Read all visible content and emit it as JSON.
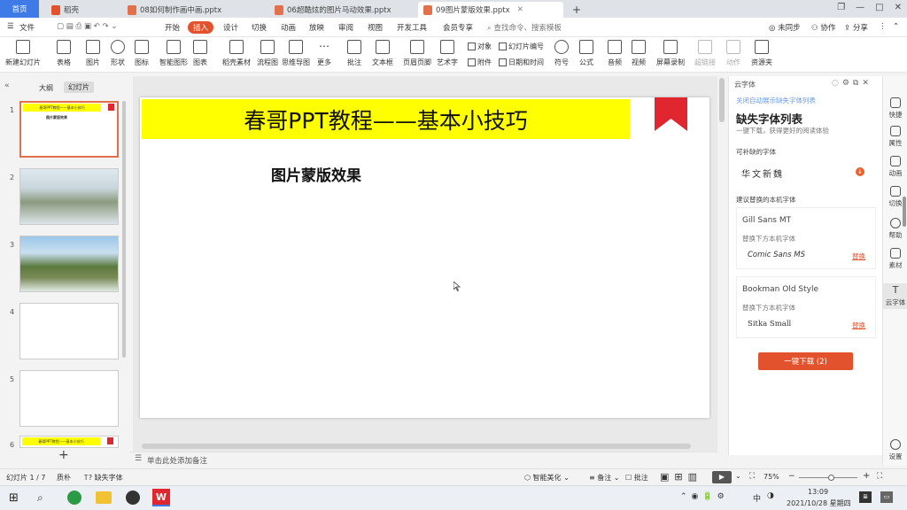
{
  "tabs": [
    {
      "label": "首页"
    },
    {
      "label": "稻壳"
    },
    {
      "label": "08如何制作画中画.pptx"
    },
    {
      "label": "06超酷炫的图片马动效果.pptx"
    },
    {
      "label": "09图片蒙版效果.pptx"
    }
  ],
  "menu": {
    "file": "文件",
    "items": [
      "开始",
      "插入",
      "设计",
      "切换",
      "动画",
      "放映",
      "审阅",
      "视图",
      "开发工具",
      "会员专享"
    ],
    "active": "插入",
    "search_placeholder": "查找命令、搜索模板",
    "sync": "未同步",
    "collab": "协作",
    "share": "分享"
  },
  "ribbon": {
    "buttons": [
      "新建幻灯片",
      "表格",
      "图片",
      "形状",
      "图标",
      "智能图形",
      "图表",
      "稻壳素材",
      "流程图",
      "思维导图",
      "更多",
      "批注",
      "文本框",
      "页眉页脚",
      "艺术字",
      "符号",
      "公式",
      "音频",
      "视频",
      "屏幕录制",
      "超链接",
      "动作",
      "资源夹"
    ],
    "small": [
      "对象",
      "幻灯片编号",
      "附件",
      "日期和时间"
    ]
  },
  "left_panel": {
    "tab_outline": "大纲",
    "tab_slides": "幻灯片",
    "slides": [
      {
        "num": "1",
        "title": "春哥PPT教程——基本小技巧",
        "subtitle": "图片蒙版效果"
      },
      {
        "num": "2"
      },
      {
        "num": "3"
      },
      {
        "num": "4"
      },
      {
        "num": "5"
      },
      {
        "num": "6",
        "title": "春哥PPT教程——基本小技巧"
      }
    ],
    "add": "+"
  },
  "slide": {
    "title": "春哥PPT教程——基本小技巧",
    "subtitle": "图片蒙版效果"
  },
  "notes_placeholder": "单击此处添加备注",
  "right_panel": {
    "header": "云字体",
    "link": "关闭自动展示缺失字体列表",
    "title": "缺失字体列表",
    "desc": "一键下载，获得更好的阅读体验",
    "section_downloadable": "可补缺的字体",
    "downloadable_font": "华文新魏",
    "section_replace": "建议替换的本机字体",
    "replacements": [
      {
        "font": "Gill Sans MT",
        "hint": "替换下方本机字体",
        "local": "Comic Sans MS",
        "action": "替换"
      },
      {
        "font": "Bookman Old Style",
        "hint": "替换下方本机字体",
        "local": "Sitka Small",
        "action": "替换"
      }
    ],
    "download_button": "一键下载 (2)"
  },
  "sidebar": [
    "快捷",
    "属性",
    "动画",
    "切换",
    "帮助",
    "素材",
    "云字体",
    "设置"
  ],
  "statusbar": {
    "slide_info": "幻灯片 1 / 7",
    "theme": "质朴",
    "missing_font": "缺失字体",
    "beautify": "智能美化",
    "notes": "备注",
    "comments": "批注",
    "zoom": "75%"
  },
  "taskbar": {
    "time": "13:09",
    "date": "2021/10/28 星期四",
    "ime": "中"
  },
  "colors": {
    "accent": "#e2532d",
    "slide_banner": "#ffff00",
    "bookmark": "#e0262f",
    "download": "#e2532d"
  }
}
